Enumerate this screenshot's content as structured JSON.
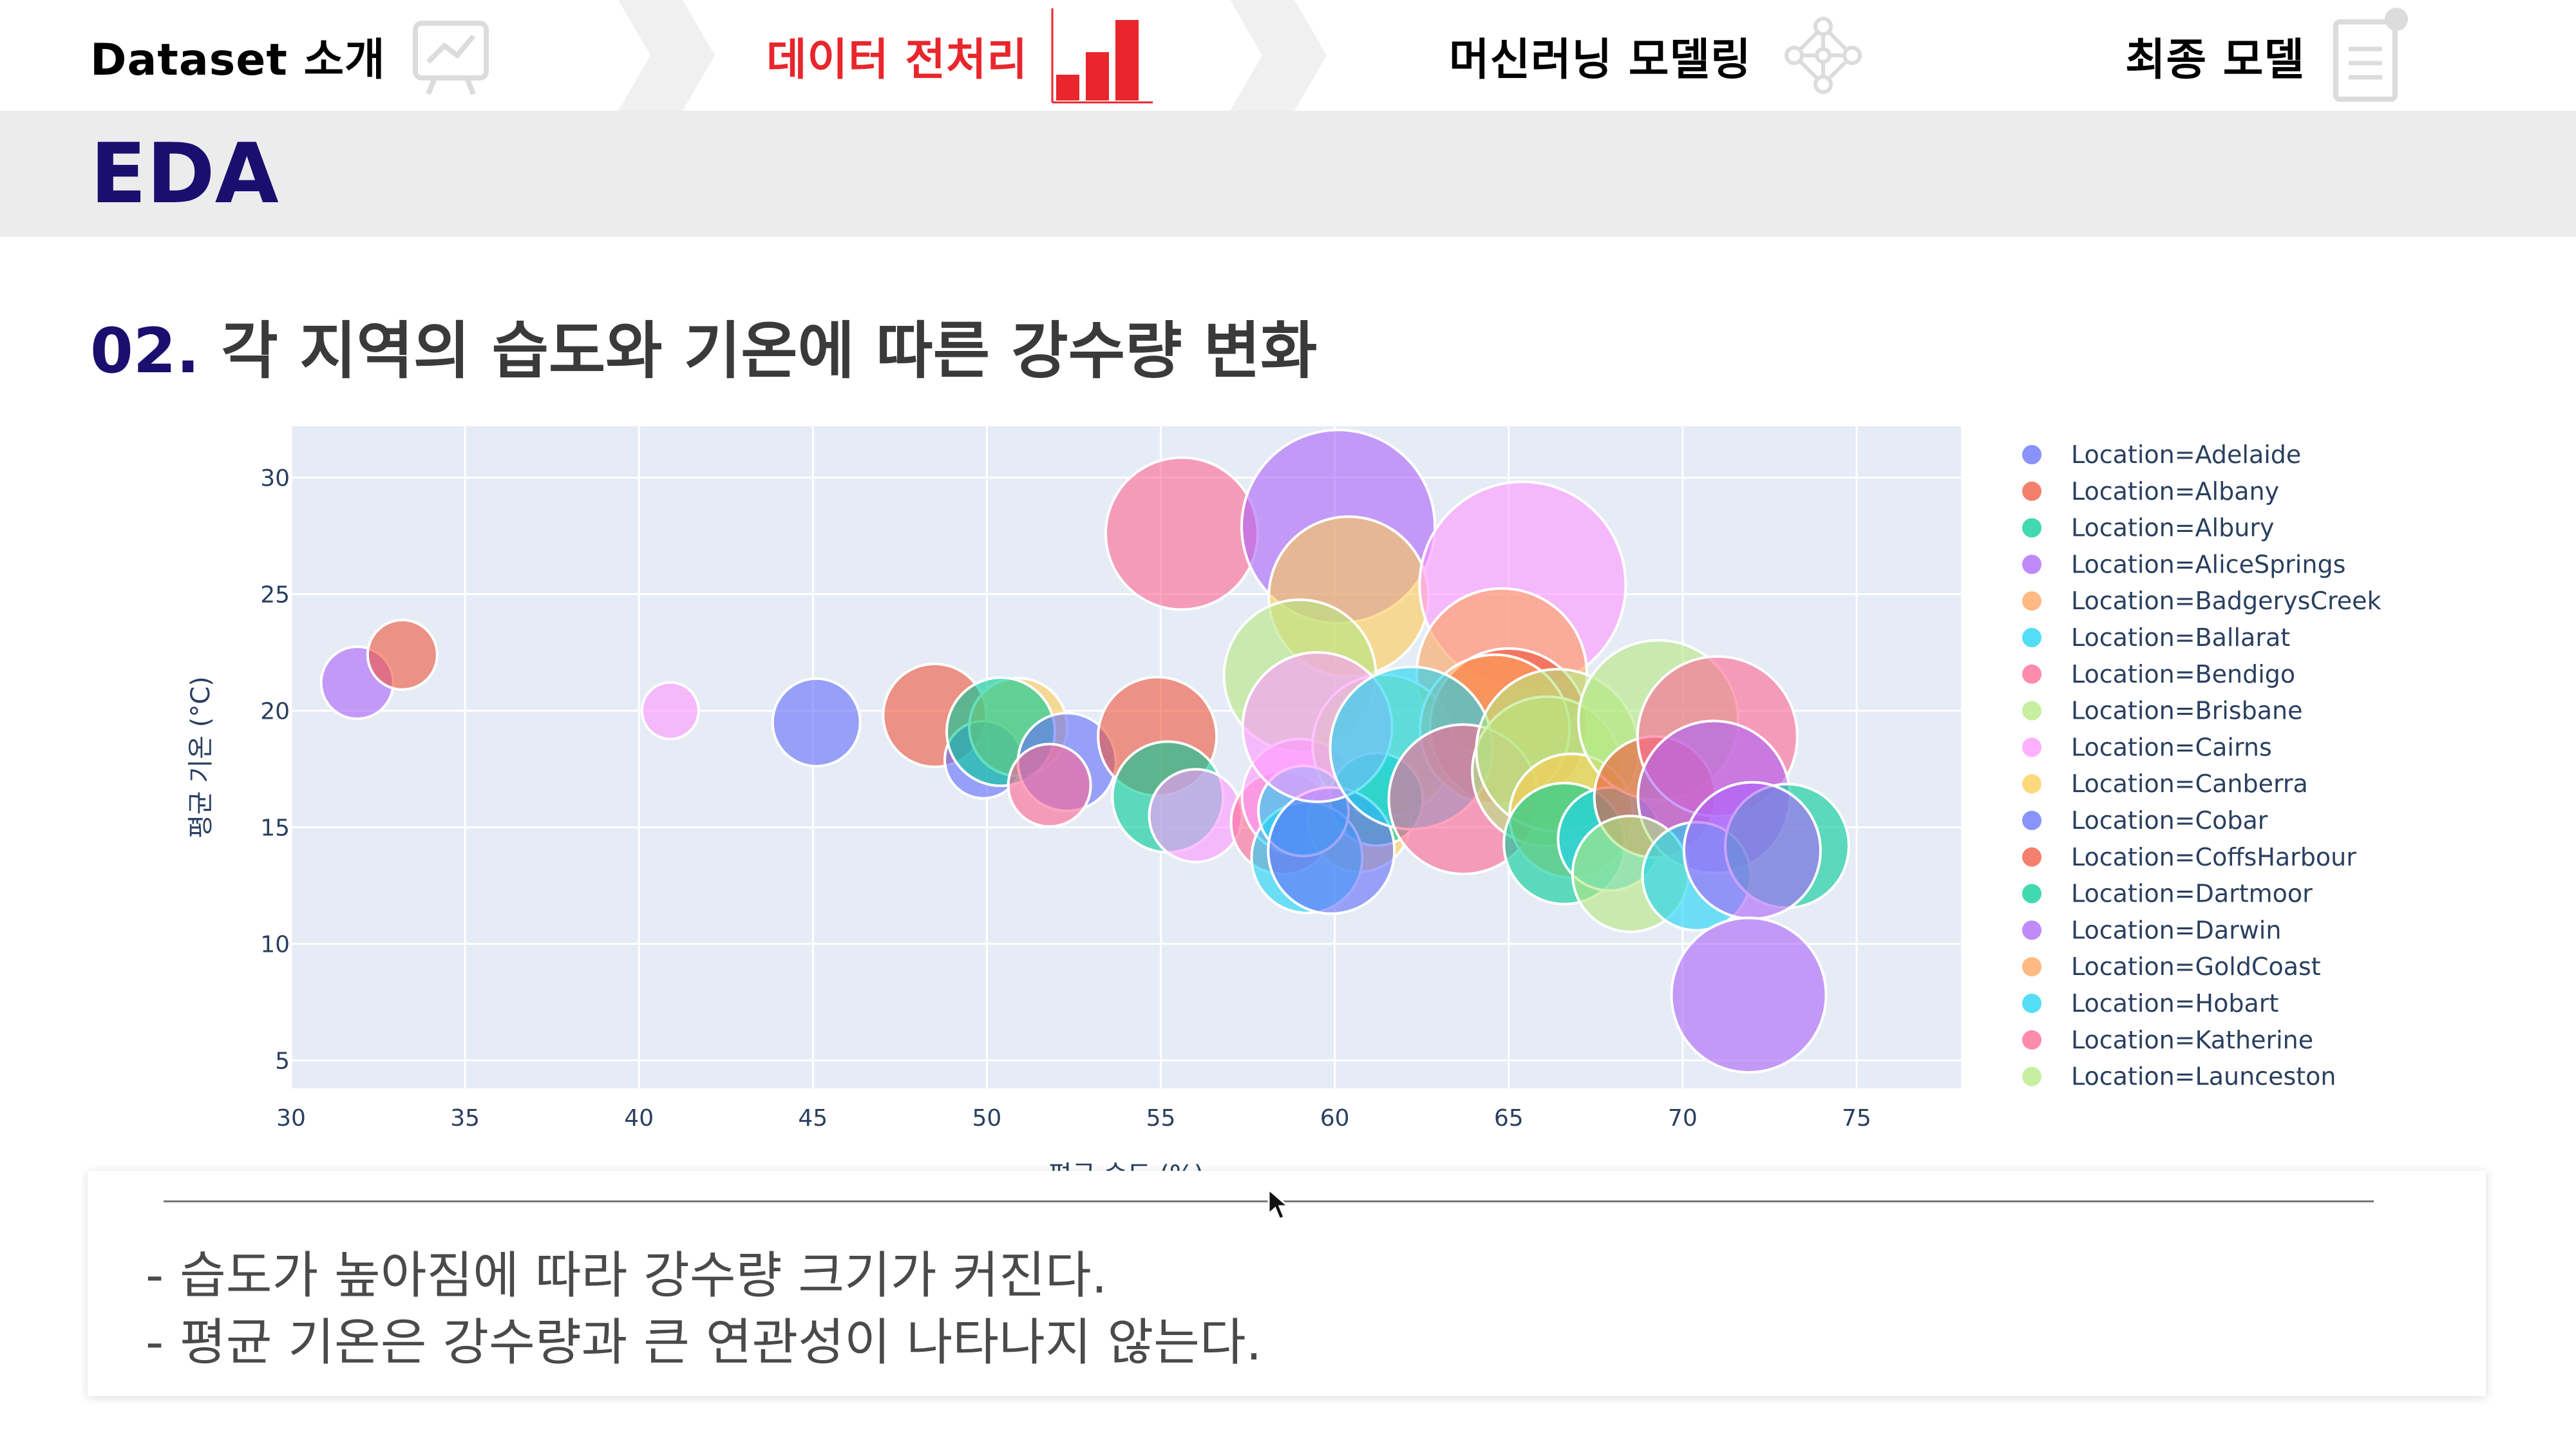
{
  "steps": [
    {
      "label": "Dataset 소개",
      "icon": "chart-board-icon",
      "active": false
    },
    {
      "label": "데이터 전처리",
      "icon": "bar-chart-icon",
      "active": true
    },
    {
      "label": "머신러닝 모델링",
      "icon": "network-icon",
      "active": false
    },
    {
      "label": "최종 모델",
      "icon": "document-icon",
      "active": false
    }
  ],
  "colors": {
    "accent": "#e8262c",
    "title": "#1a0f6e",
    "band": "#ececec",
    "plot_bg": "#e5ecf6"
  },
  "page_title": "EDA",
  "section": {
    "number": "02.",
    "title": "각 지역의 습도와 기온에 따른 강수량 변화"
  },
  "notes": [
    "- 습도가 높아짐에 따라 강수량 크기가 커진다.",
    "- 평균 기온은 강수량과 큰 연관성이 나타나지 않는다."
  ],
  "chart_data": {
    "type": "scatter",
    "variant": "bubble",
    "title": "",
    "xlabel": "평균 습도 (%)",
    "ylabel": "평균 기온 (°C)",
    "xlim": [
      30,
      78
    ],
    "ylim": [
      3.8,
      32.2
    ],
    "xticks": [
      30,
      35,
      40,
      45,
      50,
      55,
      60,
      65,
      70,
      75
    ],
    "yticks": [
      5,
      10,
      15,
      20,
      25,
      30
    ],
    "grid": true,
    "legend_position": "right",
    "size_meaning": "강수량 (relative bubble size)",
    "points": [
      {
        "series": "Location=AliceSprings",
        "color": "#ab63fa",
        "x": 31.9,
        "y": 21.2,
        "s": 0.28
      },
      {
        "series": "Location=CoffsHarbour",
        "color": "#ef553b",
        "x": 33.2,
        "y": 22.4,
        "s": 0.27
      },
      {
        "series": "Location=Cairns",
        "color": "#ff97ff",
        "x": 40.9,
        "y": 20.0,
        "s": 0.22
      },
      {
        "series": "Location=Adelaide",
        "color": "#636efa",
        "x": 45.1,
        "y": 19.5,
        "s": 0.34
      },
      {
        "series": "Location=Albany",
        "color": "#ef553b",
        "x": 48.5,
        "y": 19.8,
        "s": 0.4
      },
      {
        "series": "Location=Cobar",
        "color": "#636efa",
        "x": 49.9,
        "y": 17.9,
        "s": 0.3
      },
      {
        "series": "Location=Canberra",
        "color": "#fecb52",
        "x": 50.9,
        "y": 19.3,
        "s": 0.38
      },
      {
        "series": "Location=Dartmoor",
        "color": "#00cc96",
        "x": 50.4,
        "y": 19.1,
        "s": 0.42
      },
      {
        "series": "Location=Adelaide",
        "color": "#636efa",
        "x": 52.3,
        "y": 17.8,
        "s": 0.38
      },
      {
        "series": "Location=Bendigo",
        "color": "#ff6692",
        "x": 51.8,
        "y": 16.8,
        "s": 0.32
      },
      {
        "series": "Location=Albany",
        "color": "#ef553b",
        "x": 54.9,
        "y": 18.9,
        "s": 0.46
      },
      {
        "series": "Location=Albury",
        "color": "#00cc96",
        "x": 55.2,
        "y": 16.3,
        "s": 0.43
      },
      {
        "series": "Location=Cairns",
        "color": "#ff97ff",
        "x": 56.0,
        "y": 15.5,
        "s": 0.36
      },
      {
        "series": "Location=Bendigo",
        "color": "#ff6692",
        "x": 55.6,
        "y": 27.6,
        "s": 0.59
      },
      {
        "series": "Location=AliceSprings",
        "color": "#ab63fa",
        "x": 60.1,
        "y": 27.9,
        "s": 0.75
      },
      {
        "series": "Location=Canberra",
        "color": "#fecb52",
        "x": 60.4,
        "y": 24.9,
        "s": 0.62
      },
      {
        "series": "Location=Cairns",
        "color": "#ff97ff",
        "x": 65.4,
        "y": 25.4,
        "s": 0.8
      },
      {
        "series": "Location=Brisbane",
        "color": "#b6e880",
        "x": 59.0,
        "y": 21.5,
        "s": 0.59
      },
      {
        "series": "Location=BadgerysCreek",
        "color": "#ffa15a",
        "x": 64.8,
        "y": 21.6,
        "s": 0.66
      },
      {
        "series": "Location=Katherine",
        "color": "#ff6692",
        "x": 58.5,
        "y": 15.2,
        "s": 0.4
      },
      {
        "series": "Location=Cairns",
        "color": "#ff97ff",
        "x": 59.0,
        "y": 16.3,
        "s": 0.45
      },
      {
        "series": "Location=Canberra",
        "color": "#fecb52",
        "x": 60.7,
        "y": 15.3,
        "s": 0.4
      },
      {
        "series": "Location=Brisbane",
        "color": "#b6e880",
        "x": 61.4,
        "y": 18.5,
        "s": 0.55
      },
      {
        "series": "Location=Dartmoor",
        "color": "#00cc96",
        "x": 61.2,
        "y": 16.2,
        "s": 0.36
      },
      {
        "series": "Location=Ballarat",
        "color": "#19d3f3",
        "x": 59.2,
        "y": 13.7,
        "s": 0.43
      },
      {
        "series": "Location=Ballarat",
        "color": "#19d3f3",
        "x": 59.1,
        "y": 15.7,
        "s": 0.35
      },
      {
        "series": "Location=Cobar",
        "color": "#636efa",
        "x": 59.9,
        "y": 14.0,
        "s": 0.49
      },
      {
        "series": "Location=Cairns",
        "color": "#ff97ff",
        "x": 59.5,
        "y": 19.3,
        "s": 0.58
      },
      {
        "series": "Location=CoffsHarbour",
        "color": "#ef553b",
        "x": 65.0,
        "y": 19.3,
        "s": 0.61
      },
      {
        "series": "Location=GoldCoast",
        "color": "#ffa15a",
        "x": 64.6,
        "y": 19.2,
        "s": 0.58
      },
      {
        "series": "Location=Hobart",
        "color": "#19d3f3",
        "x": 62.2,
        "y": 18.4,
        "s": 0.63
      },
      {
        "series": "Location=Katherine",
        "color": "#ff6692",
        "x": 63.7,
        "y": 16.2,
        "s": 0.58
      },
      {
        "series": "Location=Brisbane",
        "color": "#b6e880",
        "x": 66.1,
        "y": 17.4,
        "s": 0.58
      },
      {
        "series": "Location=Launceston",
        "color": "#b6e880",
        "x": 66.4,
        "y": 18.3,
        "s": 0.63
      },
      {
        "series": "Location=Canberra",
        "color": "#fecb52",
        "x": 66.8,
        "y": 15.5,
        "s": 0.48
      },
      {
        "series": "Location=Dartmoor",
        "color": "#00cc96",
        "x": 66.6,
        "y": 14.3,
        "s": 0.47
      },
      {
        "series": "Location=Hobart",
        "color": "#19d3f3",
        "x": 67.9,
        "y": 14.5,
        "s": 0.4
      },
      {
        "series": "Location=Brisbane",
        "color": "#b6e880",
        "x": 69.3,
        "y": 19.6,
        "s": 0.62
      },
      {
        "series": "Location=CoffsHarbour",
        "color": "#ef553b",
        "x": 69.2,
        "y": 16.3,
        "s": 0.47
      },
      {
        "series": "Location=Bendigo",
        "color": "#ff6692",
        "x": 71.0,
        "y": 18.9,
        "s": 0.62
      },
      {
        "series": "Location=Darwin",
        "color": "#ab63fa",
        "x": 70.9,
        "y": 16.3,
        "s": 0.59
      },
      {
        "series": "Location=Launceston",
        "color": "#b6e880",
        "x": 68.5,
        "y": 13.0,
        "s": 0.45
      },
      {
        "series": "Location=Hobart",
        "color": "#19d3f3",
        "x": 70.4,
        "y": 12.9,
        "s": 0.42
      },
      {
        "series": "Location=Albury",
        "color": "#00cc96",
        "x": 73.0,
        "y": 14.2,
        "s": 0.48
      },
      {
        "series": "Location=Darwin",
        "color": "#ab63fa",
        "x": 72.0,
        "y": 14.0,
        "s": 0.53
      },
      {
        "series": "Location=Darwin",
        "color": "#ab63fa",
        "x": 71.9,
        "y": 7.8,
        "s": 0.6
      }
    ],
    "legend": [
      {
        "name": "Location=Adelaide",
        "color": "#636efa"
      },
      {
        "name": "Location=Albany",
        "color": "#ef553b"
      },
      {
        "name": "Location=Albury",
        "color": "#00cc96"
      },
      {
        "name": "Location=AliceSprings",
        "color": "#ab63fa"
      },
      {
        "name": "Location=BadgerysCreek",
        "color": "#ffa15a"
      },
      {
        "name": "Location=Ballarat",
        "color": "#19d3f3"
      },
      {
        "name": "Location=Bendigo",
        "color": "#ff6692"
      },
      {
        "name": "Location=Brisbane",
        "color": "#b6e880"
      },
      {
        "name": "Location=Cairns",
        "color": "#ff97ff"
      },
      {
        "name": "Location=Canberra",
        "color": "#fecb52"
      },
      {
        "name": "Location=Cobar",
        "color": "#636efa"
      },
      {
        "name": "Location=CoffsHarbour",
        "color": "#ef553b"
      },
      {
        "name": "Location=Dartmoor",
        "color": "#00cc96"
      },
      {
        "name": "Location=Darwin",
        "color": "#ab63fa"
      },
      {
        "name": "Location=GoldCoast",
        "color": "#ffa15a"
      },
      {
        "name": "Location=Hobart",
        "color": "#19d3f3"
      },
      {
        "name": "Location=Katherine",
        "color": "#ff6692"
      },
      {
        "name": "Location=Launceston",
        "color": "#b6e880"
      }
    ]
  }
}
